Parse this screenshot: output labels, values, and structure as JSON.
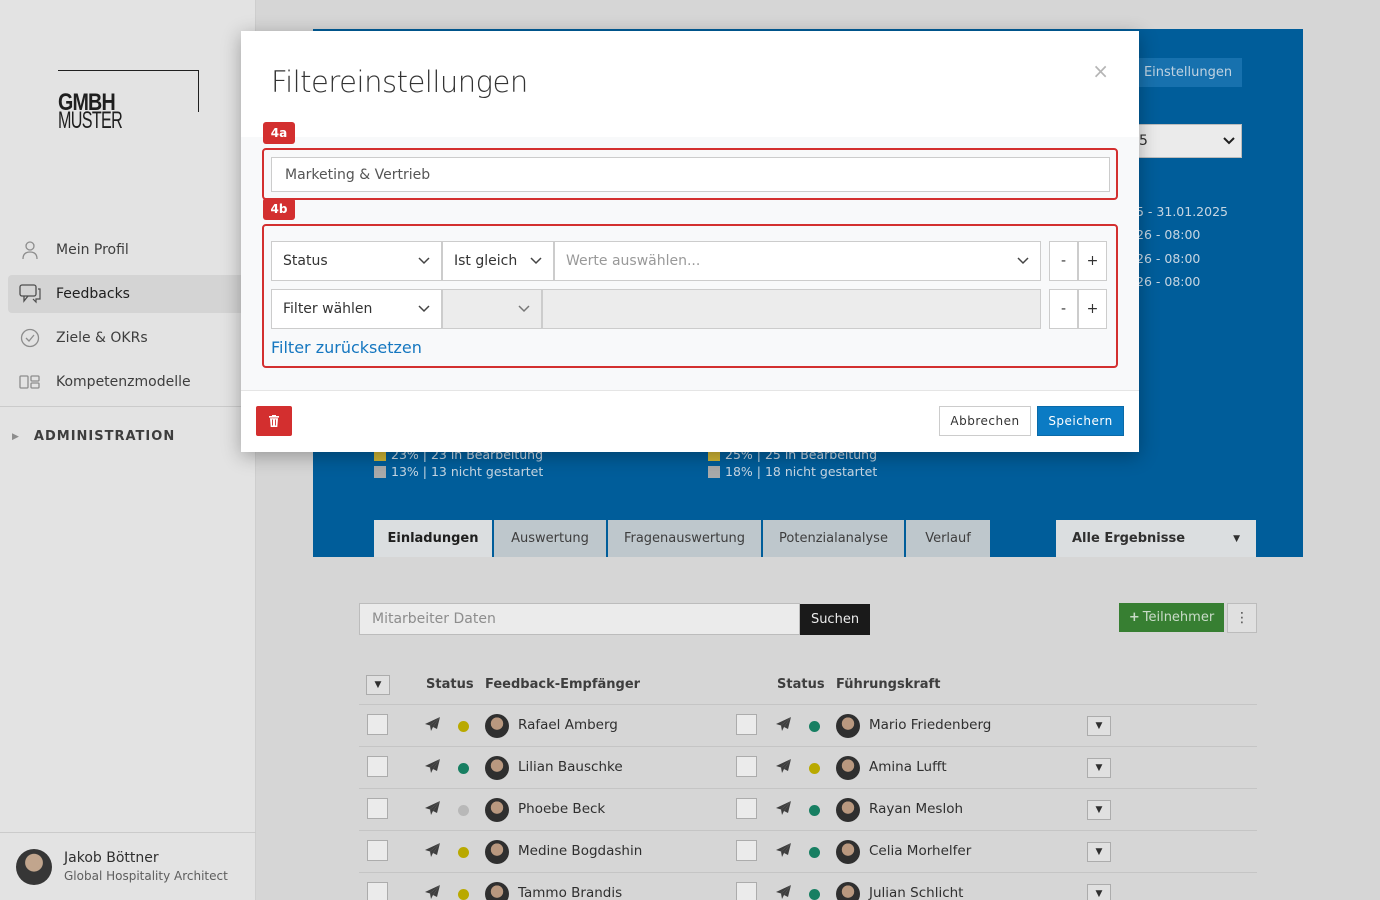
{
  "logo": {
    "light": "MUSTER",
    "bold": "GMBH"
  },
  "sidebar": {
    "items": [
      {
        "label": "Mein Profil",
        "icon": "user-icon"
      },
      {
        "label": "Feedbacks",
        "icon": "chat-icon"
      },
      {
        "label": "Ziele & OKRs",
        "icon": "check-circle-icon"
      },
      {
        "label": "Kompetenzmodelle",
        "icon": "model-icon"
      }
    ],
    "admin_label": "ADMINISTRATION"
  },
  "user": {
    "name": "Jakob Böttner",
    "role": "Global Hospitality Architect"
  },
  "header": {
    "settings_label": "Einstellungen",
    "select_value": "5",
    "dates": [
      "5 - 31.01.2025",
      "26 - 08:00",
      "26 - 08:00",
      "26 - 08:00"
    ]
  },
  "legend": {
    "left": [
      "23% | 23 in Bearbeitung",
      "13% | 13 nicht gestartet"
    ],
    "right": [
      "25% | 25 in Bearbeitung",
      "18% | 18 nicht gestartet"
    ],
    "colors": {
      "in_progress": "#e0c43a",
      "not_started": "#b9b9b9"
    }
  },
  "tabs": [
    "Einladungen",
    "Auswertung",
    "Fragenauswertung",
    "Potenzialanalyse",
    "Verlauf"
  ],
  "results_filter": "Alle Ergebnisse",
  "search": {
    "placeholder": "Mitarbeiter Daten",
    "button": "Suchen"
  },
  "add_participant_label": "Teilnehmer",
  "table": {
    "headers": {
      "status1": "Status",
      "recipient": "Feedback-Empfänger",
      "status2": "Status",
      "manager": "Führungskraft"
    },
    "rows": [
      {
        "recipient": "Rafael Amberg",
        "status1": "#c9b800",
        "manager": "Mario Friedenberg",
        "status2": "#1a8a6b"
      },
      {
        "recipient": "Lilian Bauschke",
        "status1": "#1a8a6b",
        "manager": "Amina Lufft",
        "status2": "#c9b800"
      },
      {
        "recipient": "Phoebe Beck",
        "status1": "#c8c8c8",
        "manager": "Rayan Mesloh",
        "status2": "#1a8a6b"
      },
      {
        "recipient": "Medine Bogdashin",
        "status1": "#c9b800",
        "manager": "Celia Morhelfer",
        "status2": "#1a8a6b"
      },
      {
        "recipient": "Tammo Brandis",
        "status1": "#c9b800",
        "manager": "Julian Schlicht",
        "status2": "#1a8a6b"
      }
    ]
  },
  "modal": {
    "title": "Filtereinstellungen",
    "close": "×",
    "tag_a": "4a",
    "tag_b": "4b",
    "name_value": "Marketing & Vertrieb",
    "filter1": {
      "field": "Status",
      "operator": "Ist gleich",
      "values_placeholder": "Werte auswählen..."
    },
    "filter2": {
      "field": "Filter wählen"
    },
    "minus": "-",
    "plus": "+",
    "reset_label": "Filter zurücksetzen",
    "cancel_label": "Abbrechen",
    "save_label": "Speichern"
  }
}
